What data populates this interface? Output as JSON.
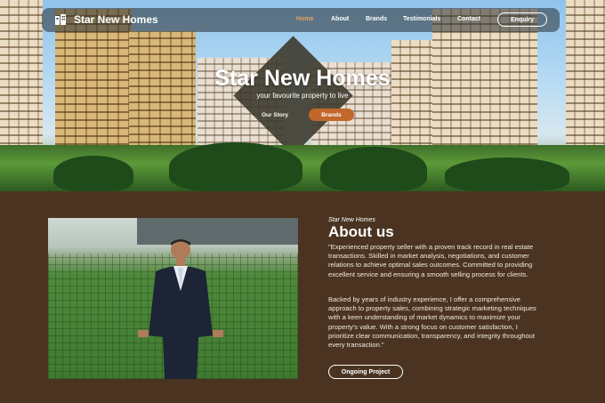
{
  "nav": {
    "brand": "Star New Homes",
    "links": [
      "Home",
      "About",
      "Brands",
      "Testimonials",
      "Contact"
    ],
    "active": "Home",
    "enquiry_label": "Enquiry",
    "logo_icon": "building-icon"
  },
  "hero": {
    "title": "Star New Homes",
    "subtitle": "your favourite property to live",
    "story_button": "Our Story",
    "brands_button": "Brands"
  },
  "about": {
    "eyebrow": "Star New Homes",
    "title": "About us",
    "paragraph_1": "\"Experienced property seller with a proven track record in real estate transactions. Skilled in market analysis, negotiations, and customer relations to achieve optimal sales outcomes. Committed to providing excellent service and ensuring a smooth selling process for clients.",
    "paragraph_2": "Backed by years of industry experience, I offer a comprehensive approach to property sales, combining strategic marketing techniques with a keen understanding of market dynamics to maximize your property's value. With a strong focus on customer satisfaction, I prioritize clear communication, transparency, and integrity throughout every transaction.\"",
    "ongoing_button": "Ongoing Project"
  },
  "colors": {
    "background": "#4a3421",
    "accent": "#c2672c",
    "active_link": "#e8a25f"
  }
}
